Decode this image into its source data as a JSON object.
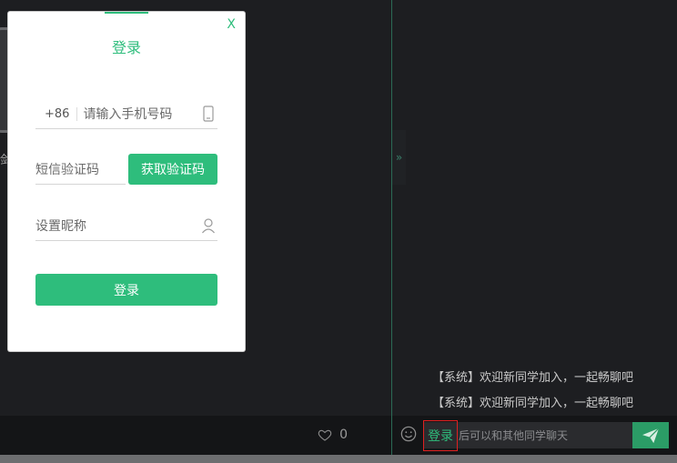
{
  "video": {
    "partial_label": "剑"
  },
  "chat": {
    "messages": [
      "【系统】欢迎新同学加入，一起畅聊吧",
      "【系统】欢迎新同学加入，一起畅聊吧"
    ],
    "input": {
      "login_link": "登录",
      "placeholder": "后可以和其他同学聊天"
    }
  },
  "like": {
    "count": "0"
  },
  "modal": {
    "title": "登录",
    "close_label": "X",
    "phone": {
      "prefix": "+86",
      "placeholder": "请输入手机号码"
    },
    "sms_code": {
      "placeholder": "短信验证码",
      "button": "获取验证码"
    },
    "nickname": {
      "placeholder": "设置昵称"
    },
    "submit": "登录"
  },
  "colors": {
    "accent": "#2ebd7c",
    "highlight_box": "#e02020"
  }
}
